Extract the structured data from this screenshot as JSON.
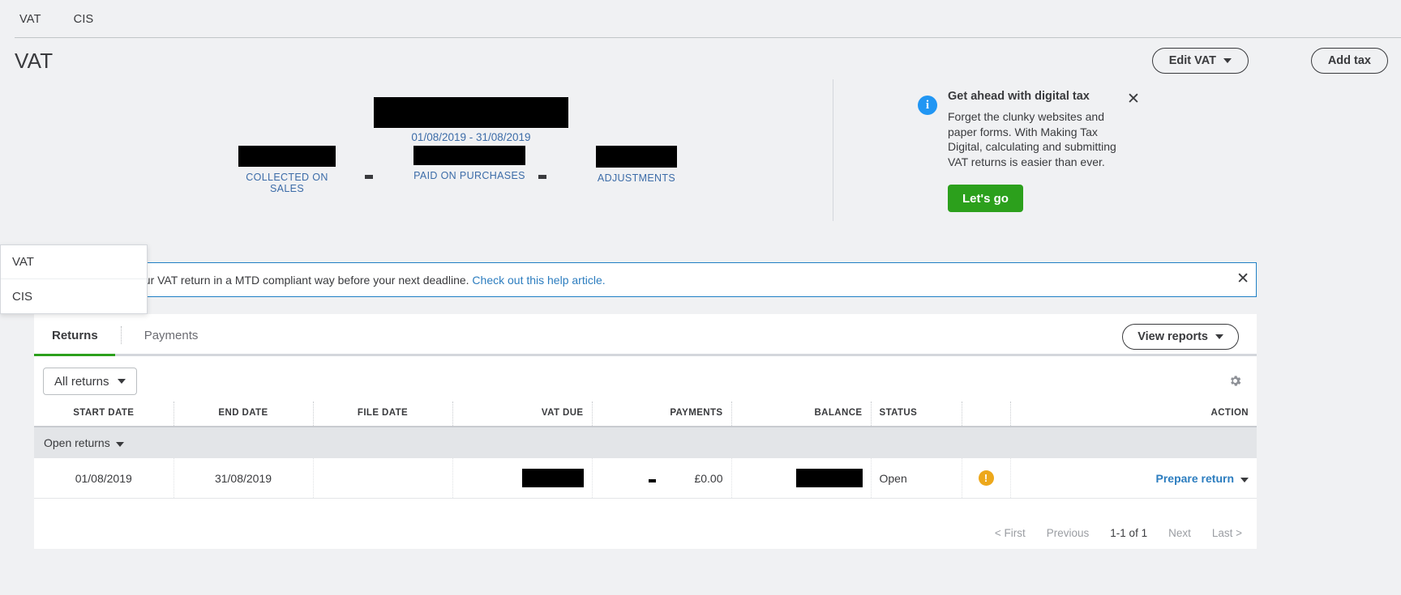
{
  "topnav": {
    "items": [
      {
        "label": "VAT"
      },
      {
        "label": "CIS"
      }
    ]
  },
  "header": {
    "title": "VAT",
    "edit_vat_label": "Edit VAT",
    "add_tax_label": "Add tax"
  },
  "summary": {
    "period": "01/08/2019 - 31/08/2019",
    "minus_1": "-",
    "minus_2": "-",
    "stats": [
      {
        "label": "COLLECTED ON SALES"
      },
      {
        "label": "PAID ON PURCHASES"
      },
      {
        "label": "ADJUSTMENTS"
      }
    ]
  },
  "info_card": {
    "icon": "info-icon",
    "title": "Get ahead with digital tax",
    "body": "Forget the clunky websites and paper forms. With Making Tax Digital, calculating and submitting VAT returns is easier than ever.",
    "cta_label": "Let's go",
    "close_label": "✕"
  },
  "banner": {
    "text": "your VAT return in a MTD compliant way before your next deadline. ",
    "link_text": "Check out this help article.",
    "close_label": "✕"
  },
  "dropdown": {
    "items": [
      {
        "label": "VAT"
      },
      {
        "label": "CIS"
      }
    ]
  },
  "panel": {
    "tabs": [
      {
        "label": "Returns",
        "active": true
      },
      {
        "label": "Payments",
        "active": false
      }
    ],
    "view_reports_label": "View reports",
    "filter_label": "All returns",
    "gear_icon": "gear-icon",
    "columns": [
      "START DATE",
      "END DATE",
      "FILE DATE",
      "VAT DUE",
      "PAYMENTS",
      "BALANCE",
      "STATUS",
      "",
      "ACTION"
    ],
    "group_label": "Open returns",
    "rows": [
      {
        "start_date": "01/08/2019",
        "end_date": "31/08/2019",
        "file_date": "",
        "vat_due": "",
        "payments_sign": "-",
        "payments": "£0.00",
        "balance": "",
        "status": "Open",
        "warn_icon": "warning-icon",
        "action": "Prepare return"
      }
    ],
    "pagination": {
      "first": "< First",
      "previous": "Previous",
      "range": "1-1 of 1",
      "next": "Next",
      "last": "Last >"
    }
  },
  "colors": {
    "accent_green": "#2ca01c",
    "link_blue": "#2c7dbf",
    "warn_amber": "#eda81b",
    "page_bg": "#f0f1f3"
  }
}
